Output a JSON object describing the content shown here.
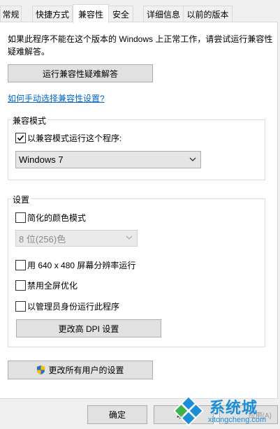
{
  "tabs": [
    {
      "label": "常规"
    },
    {
      "label": "快捷方式"
    },
    {
      "label": "兼容性"
    },
    {
      "label": "安全"
    },
    {
      "label": "详细信息"
    },
    {
      "label": "以前的版本"
    }
  ],
  "intro_text": "如果此程序不能在这个版本的 Windows 上正常工作，请尝试运行兼容性疑难解答。",
  "troubleshooter_button": "运行兼容性疑难解答",
  "manual_link": "如何手动选择兼容性设置?",
  "compat_mode": {
    "title": "兼容模式",
    "checkbox_label": "以兼容模式运行这个程序:",
    "checked": true,
    "selected_os": "Windows 7"
  },
  "settings": {
    "title": "设置",
    "reduced_color_label": "简化的颜色模式",
    "reduced_color_checked": false,
    "color_select_value": "8 位(256)色",
    "res_640_label": "用 640 x 480 屏幕分辨率运行",
    "res_640_checked": false,
    "disable_fullscreen_label": "禁用全屏优化",
    "disable_fullscreen_checked": false,
    "run_as_admin_label": "以管理员身份运行此程序",
    "run_as_admin_checked": false,
    "dpi_button": "更改高 DPI 设置"
  },
  "all_users_button": "更改所有用户的设置",
  "footer": {
    "ok_label": "确定",
    "cancel_label": "取",
    "apply_label": "应用(A)"
  },
  "watermark": {
    "brand": "系统城",
    "domain": "xitongcheng.com"
  },
  "colors": {
    "link": "#0066cc",
    "watermark_blue": "#1a8fd8",
    "watermark_green": "#3cb44a"
  }
}
